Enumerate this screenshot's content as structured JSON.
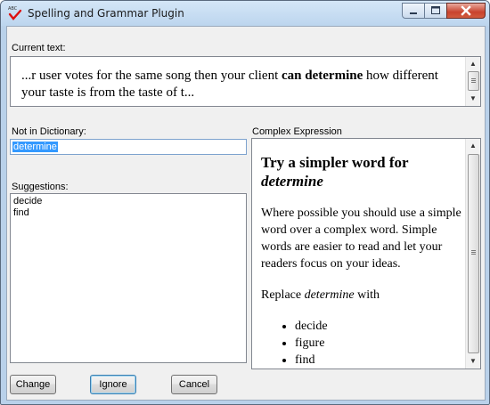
{
  "window": {
    "title": "Spelling and Grammar Plugin",
    "icon": "abc-check-icon"
  },
  "current_text": {
    "label": "Current text:",
    "before": "...r user votes for the same song then your client ",
    "highlight": "can determine",
    "after": " how different your taste is from the taste of t..."
  },
  "not_in_dictionary": {
    "label": "Not in Dictionary:",
    "value": "determine"
  },
  "suggestions": {
    "label": "Suggestions:",
    "items": [
      "decide",
      "find"
    ]
  },
  "complex_expression": {
    "label": "Complex Expression",
    "heading_prefix": "Try a simpler word for ",
    "heading_word": "determine",
    "paragraph": "Where possible you should use a simple word over a complex word. Simple words are easier to read and let your readers focus on your ideas.",
    "replace_prefix": "Replace ",
    "replace_word": "determine",
    "replace_suffix": " with",
    "options": [
      "decide",
      "figure",
      "find"
    ]
  },
  "buttons": {
    "change": "Change",
    "ignore": "Ignore",
    "cancel": "Cancel"
  },
  "colors": {
    "accent_selection": "#3399ff",
    "close_button": "#c8432e",
    "titlebar": "#bcd5ee"
  }
}
